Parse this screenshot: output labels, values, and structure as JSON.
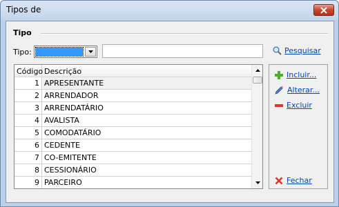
{
  "window": {
    "title": "Tipos de"
  },
  "group": {
    "label": "Tipo"
  },
  "filter": {
    "tipo_label": "Tipo:",
    "tipo_value": "",
    "search_value": "",
    "search_button": "Pesquisar"
  },
  "grid": {
    "columns": [
      "Código",
      "Descrição"
    ],
    "rows": [
      {
        "codigo": "1",
        "descricao": "APRESENTANTE"
      },
      {
        "codigo": "2",
        "descricao": "ARRENDADOR"
      },
      {
        "codigo": "3",
        "descricao": "ARRENDATÁRIO"
      },
      {
        "codigo": "4",
        "descricao": "AVALISTA"
      },
      {
        "codigo": "5",
        "descricao": "COMODATÁRIO"
      },
      {
        "codigo": "6",
        "descricao": "CEDENTE"
      },
      {
        "codigo": "7",
        "descricao": "CO-EMITENTE"
      },
      {
        "codigo": "8",
        "descricao": "CESSIONÁRIO"
      },
      {
        "codigo": "9",
        "descricao": "PARCEIRO"
      }
    ]
  },
  "actions": {
    "incluir": "Incluir...",
    "alterar": "Alterar...",
    "excluir": "Excluir",
    "fechar": "Fechar"
  },
  "colors": {
    "link": "#0645ad",
    "selection": "#3399ff",
    "add_icon": "#4caf29",
    "delete_icon": "#d9372a",
    "close_icon": "#d9372a"
  }
}
